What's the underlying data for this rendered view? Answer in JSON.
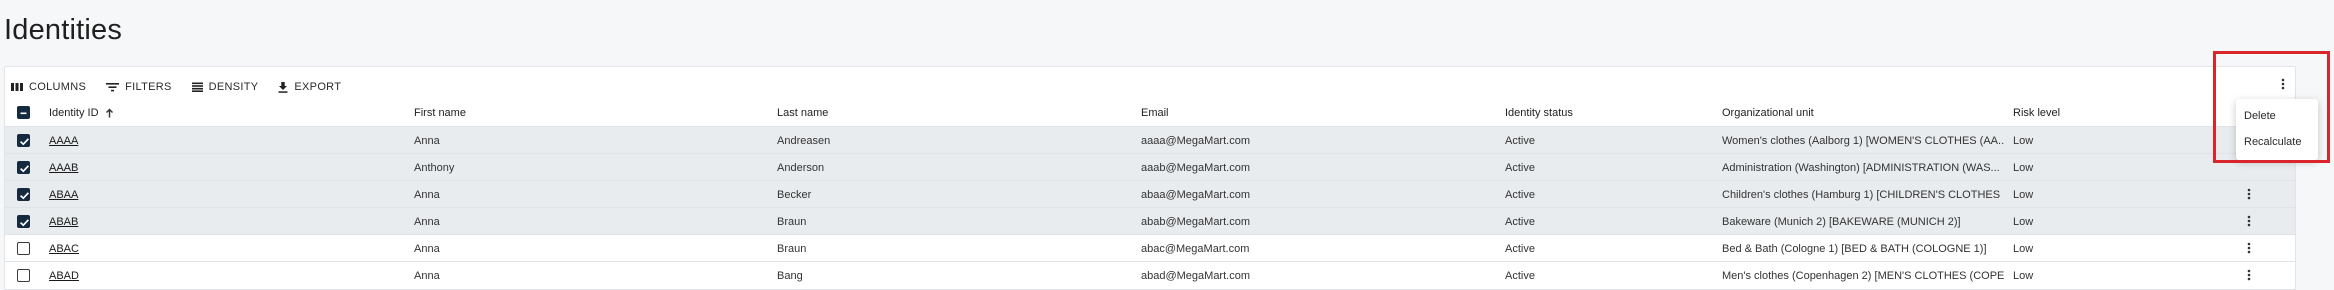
{
  "page": {
    "title": "Identities"
  },
  "toolbar": {
    "columns_label": "COLUMNS",
    "filters_label": "FILTERS",
    "density_label": "DENSITY",
    "export_label": "EXPORT"
  },
  "table": {
    "columns": [
      {
        "key": "id",
        "label": "Identity ID",
        "sorted": "asc"
      },
      {
        "key": "first",
        "label": "First name"
      },
      {
        "key": "last",
        "label": "Last name"
      },
      {
        "key": "email",
        "label": "Email"
      },
      {
        "key": "status",
        "label": "Identity status"
      },
      {
        "key": "org",
        "label": "Organizational unit"
      },
      {
        "key": "risk",
        "label": "Risk level"
      }
    ],
    "rows": [
      {
        "selected": true,
        "id": "AAAA",
        "first": "Anna",
        "last": "Andreasen",
        "email": "aaaa@MegaMart.com",
        "status": "Active",
        "org": "Women's clothes (Aalborg 1) [WOMEN'S CLOTHES (AA...",
        "risk": "Low"
      },
      {
        "selected": true,
        "id": "AAAB",
        "first": "Anthony",
        "last": "Anderson",
        "email": "aaab@MegaMart.com",
        "status": "Active",
        "org": "Administration (Washington) [ADMINISTRATION (WAS...",
        "risk": "Low"
      },
      {
        "selected": true,
        "id": "ABAA",
        "first": "Anna",
        "last": "Becker",
        "email": "abaa@MegaMart.com",
        "status": "Active",
        "org": "Children's clothes (Hamburg 1) [CHILDREN'S CLOTHES ...",
        "risk": "Low"
      },
      {
        "selected": true,
        "id": "ABAB",
        "first": "Anna",
        "last": "Braun",
        "email": "abab@MegaMart.com",
        "status": "Active",
        "org": "Bakeware (Munich 2) [BAKEWARE (MUNICH 2)]",
        "risk": "Low"
      },
      {
        "selected": false,
        "id": "ABAC",
        "first": "Anna",
        "last": "Braun",
        "email": "abac@MegaMart.com",
        "status": "Active",
        "org": "Bed & Bath (Cologne 1) [BED & BATH (COLOGNE 1)]",
        "risk": "Low"
      },
      {
        "selected": false,
        "id": "ABAD",
        "first": "Anna",
        "last": "Bang",
        "email": "abad@MegaMart.com",
        "status": "Active",
        "org": "Men's clothes (Copenhagen 2) [MEN'S CLOTHES (COPE...",
        "risk": "Low"
      }
    ]
  },
  "context_menu": {
    "items": [
      {
        "label": "Delete"
      },
      {
        "label": "Recalculate"
      }
    ]
  },
  "colors": {
    "selected_row_bg": "#e9ecef",
    "checkbox_checked": "#15293f",
    "highlight_border": "#d9262c"
  },
  "icons": [
    "columns-icon",
    "filter-icon",
    "density-icon",
    "export-icon",
    "sort-ascending-icon",
    "kebab-icon",
    "checkbox-icon"
  ]
}
